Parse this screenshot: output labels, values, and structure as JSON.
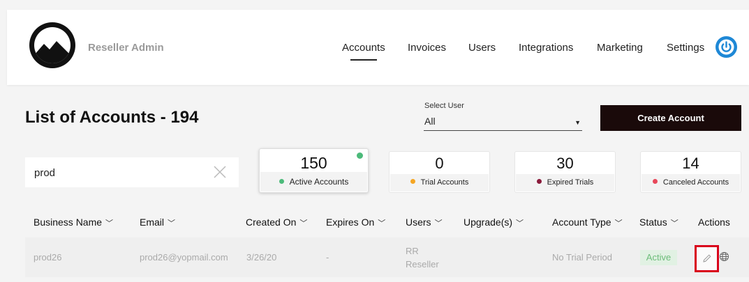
{
  "header": {
    "app_name": "Reseller Admin",
    "nav": [
      "Accounts",
      "Invoices",
      "Users",
      "Integrations",
      "Marketing",
      "Settings"
    ],
    "active_nav": "Accounts"
  },
  "page": {
    "title": "List of Accounts - 194",
    "select_user_label": "Select User",
    "select_user_value": "All",
    "create_button": "Create Account",
    "search_value": "prod"
  },
  "stats": [
    {
      "value": "150",
      "label": "Active Accounts",
      "color": "#4cba7a"
    },
    {
      "value": "0",
      "label": "Trial Accounts",
      "color": "#f5a623"
    },
    {
      "value": "30",
      "label": "Expired Trials",
      "color": "#8a1a3a"
    },
    {
      "value": "14",
      "label": "Canceled Accounts",
      "color": "#e8475a"
    }
  ],
  "table": {
    "columns": [
      "Business Name",
      "Email",
      "Created On",
      "Expires On",
      "Users",
      "Upgrade(s)",
      "Account Type",
      "Status",
      "Actions"
    ],
    "rows": [
      {
        "business": "prod26",
        "email": "prod26@yopmail.com",
        "created": "3/26/20",
        "expires": "-",
        "users_line1": "RR",
        "users_line2": "Reseller",
        "account_type": "No Trial Period",
        "status": "Active"
      }
    ]
  },
  "colors": {
    "accent": "#1e88d6",
    "create_button": "#1a0a0a",
    "status_active": "#6dbd7a",
    "highlight": "#d9001b"
  },
  "icons": {
    "logo": "mountain-logo",
    "power": "power-icon",
    "clear": "close-icon",
    "edit": "pencil-icon",
    "web": "globe-icon",
    "sort": "chevron-down-icon",
    "select": "caret-down-icon"
  }
}
